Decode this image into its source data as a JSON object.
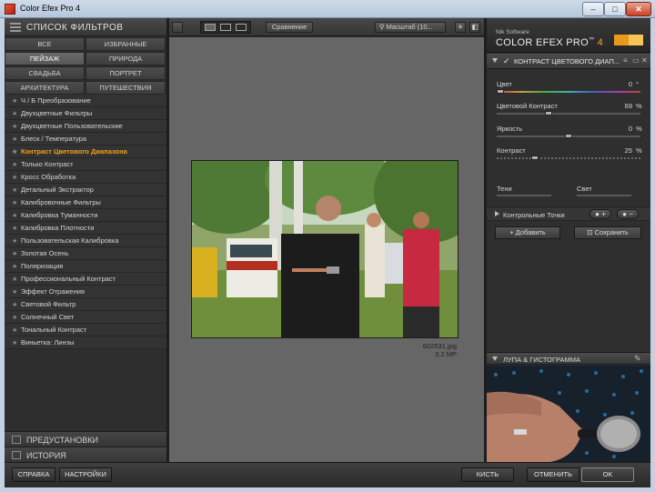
{
  "window": {
    "title": "Color Efex Pro 4",
    "min_glyph": "–",
    "max_glyph": "□",
    "close_glyph": "✕"
  },
  "left_panel": {
    "header": "СПИСОК ФИЛЬТРОВ",
    "categories": [
      {
        "label": "ВСЕ",
        "active": false
      },
      {
        "label": "ИЗБРАННЫЕ",
        "active": false
      },
      {
        "label": "ПЕЙЗАЖ",
        "active": true
      },
      {
        "label": "ПРИРОДА",
        "active": false
      },
      {
        "label": "СВАДЬБА",
        "active": false
      },
      {
        "label": "ПОРТРЕТ",
        "active": false
      },
      {
        "label": "АРХИТЕКТУРА",
        "active": false
      },
      {
        "label": "ПУТЕШЕСТВИЯ",
        "active": false
      }
    ],
    "filters": [
      "Ч / Б Преобразование",
      "Двухцветные Фильтры",
      "Двухцветные Пользовательские",
      "Блеск / Температура",
      "Контраст Цветового Диапазона",
      "Только Контраст",
      "Кросс Обработка",
      "Детальный Экстрактор",
      "Калибровочные Фильтры",
      "Калибровка Туманности",
      "Калибровка Плотности",
      "Пользовательская Калибровка",
      "Золотая Осень",
      "Поляризация",
      "Профессиональный Контраст",
      "Эффект Отражения",
      "Световой Фильтр",
      "Солнечный Свет",
      "Тональный Контраст",
      "Виньетка: Линзы"
    ],
    "selected_filter_index": 4,
    "star_glyph": "★",
    "presets": "ПРЕДУСТАНОВКИ",
    "history": "ИСТОРИЯ"
  },
  "toolbar": {
    "compare": "Сравнение",
    "zoom": "Масштаб (10...",
    "zoom_arrow": "▾"
  },
  "canvas": {
    "filename": "602531.jpg",
    "size": "3.2 MP"
  },
  "right_panel": {
    "brand_small": "Nik Software",
    "brand_name": "COLOR EFEX PRO",
    "brand_tm": "™",
    "brand_version": "4",
    "filter_title": "КОНТРАСТ ЦВЕТОВОГО ДИАП...",
    "checkmark": "✓",
    "sliders": [
      {
        "label": "Цвет",
        "value": "0",
        "unit": "°",
        "level": 0.0
      },
      {
        "label": "Цветовой Контраст",
        "value": "69",
        "unit": "%",
        "level": 0.35
      },
      {
        "label": "Яркость",
        "value": "0",
        "unit": "%",
        "level": 0.5
      },
      {
        "label": "Контраст",
        "value": "25",
        "unit": "%",
        "level": 0.25
      }
    ],
    "shadows": "Тени",
    "highlights": "Свет",
    "control_points": "Контрольные Точки",
    "cp_add": "+",
    "cp_remove": "−",
    "add_btn": "+ Добавить",
    "save_btn": "Сохранить",
    "loupe_header": "ЛУПА & ГИСТОГРАММА",
    "pin": "✎"
  },
  "bottom": {
    "help": "СПРАВКА",
    "settings": "НАСТРОЙКИ",
    "brush": "КИСТЬ",
    "cancel": "ОТМЕНИТЬ",
    "ok": "OK"
  },
  "colors": {
    "accent": "#f2a11a",
    "panel": "#2e2e2e",
    "canvas": "#666666"
  }
}
